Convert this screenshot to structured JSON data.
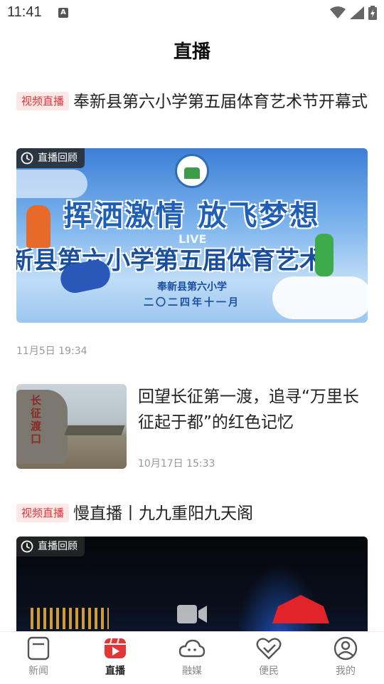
{
  "status_bar": {
    "time": "11:41",
    "notification_icon": "a-notification-icon",
    "icons": [
      "wifi-icon",
      "signal-icon",
      "battery-icon"
    ]
  },
  "header": {
    "title": "直播"
  },
  "articles": [
    {
      "tag": "视频直播",
      "title": "奉新县第六小学第五届体育艺术节开幕式",
      "badge": "直播回顾",
      "banner": {
        "slogan": "挥洒激情  放飞梦想",
        "subtitle": "新县第六小学第五届体育艺术",
        "school": "奉新县第六小学",
        "date": "二〇二四年十一月",
        "overlay": "LIVE"
      },
      "time": "11月5日 19:34"
    },
    {
      "title": "回望长征第一渡，追寻“万里长征起于都”的红色记忆",
      "thumb_text": "长征渡口",
      "time": "10月17日 15:33"
    },
    {
      "tag": "视频直播",
      "title": "慢直播丨九九重阳九天阁",
      "badge": "直播回顾"
    }
  ],
  "bottom_nav": {
    "items": [
      {
        "label": "新闻",
        "icon": "news-icon",
        "active": false
      },
      {
        "label": "直播",
        "icon": "live-icon",
        "active": true
      },
      {
        "label": "融媒",
        "icon": "cloud-icon",
        "active": false
      },
      {
        "label": "便民",
        "icon": "heart-hands-icon",
        "active": false
      },
      {
        "label": "我的",
        "icon": "user-icon",
        "active": false
      }
    ]
  },
  "colors": {
    "accent": "#e33636",
    "tag_bg": "#fde8e8"
  }
}
